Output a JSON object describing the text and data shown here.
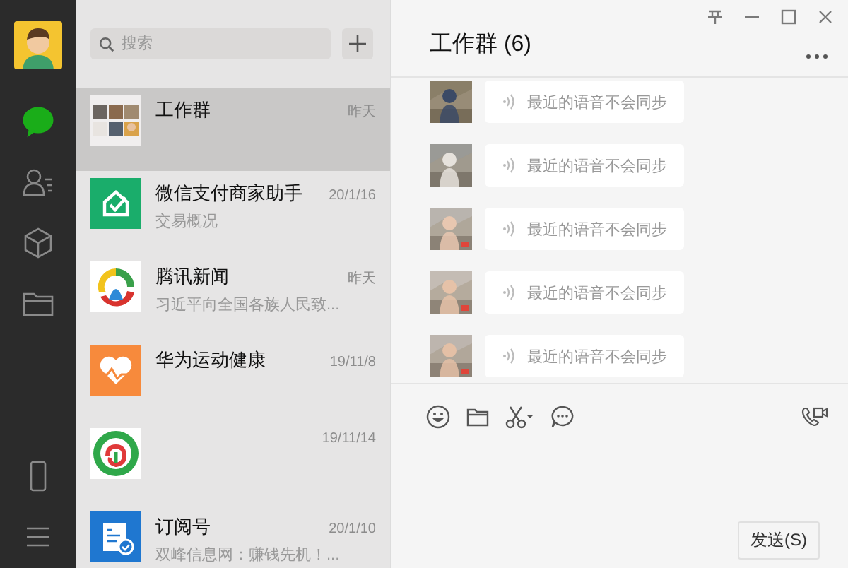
{
  "sidebar": {
    "items": [
      {
        "kind": "chat",
        "selected": true
      },
      {
        "kind": "contacts",
        "selected": false
      },
      {
        "kind": "favorites",
        "selected": false
      },
      {
        "kind": "files",
        "selected": false
      }
    ]
  },
  "chat_list": {
    "search": {
      "placeholder": "搜索"
    },
    "items": [
      {
        "kind": "picture",
        "name": "工作群",
        "time": "昨天",
        "selected": true
      },
      {
        "kind": "pay",
        "name": "微信支付商家助手",
        "time": "20/1/16",
        "preview": "交易概况",
        "selected": false
      },
      {
        "kind": "news",
        "name": "腾讯新闻",
        "time": "昨天",
        "preview": "习近平向全国各族人民致...",
        "selected": false
      },
      {
        "kind": "health",
        "name": "华为运动健康",
        "time": "19/11/8",
        "selected": false
      },
      {
        "kind": "emblem",
        "time": "19/11/14",
        "selected": false
      },
      {
        "kind": "subscription",
        "name": "订阅号",
        "time": "20/1/10",
        "preview": "双峰信息网：赚钱先机！...",
        "selected": false
      }
    ]
  },
  "chat": {
    "title": "工作群 (6)",
    "messages": [
      {
        "text": "最近的语音不会同步"
      },
      {
        "text": "最近的语音不会同步"
      },
      {
        "text": "最近的语音不会同步"
      },
      {
        "text": "最近的语音不会同步"
      },
      {
        "text": "最近的语音不会同步"
      }
    ],
    "send_button": "发送(S)"
  }
}
